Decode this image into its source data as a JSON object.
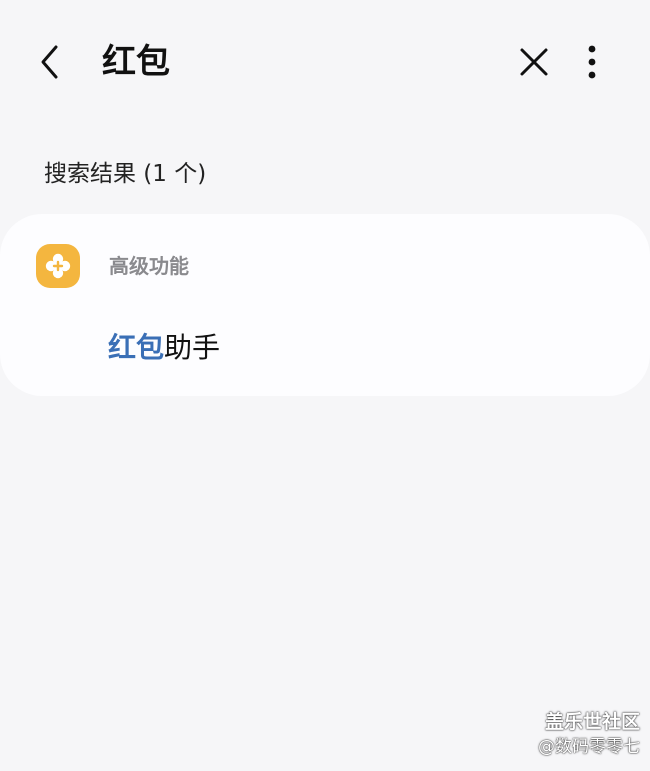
{
  "app_bar": {
    "title": "红包",
    "back_icon": "chevron-left-icon",
    "close_icon": "close-icon",
    "more_icon": "more-vertical-icon"
  },
  "results": {
    "header": "搜索结果 (1 个)",
    "items": [
      {
        "category": "高级功能",
        "icon": "advanced-features-icon",
        "icon_color": "#f4b63f",
        "title_highlight": "红包",
        "title_rest": "助手",
        "highlight_color": "#3a6fb6"
      }
    ]
  },
  "watermark": {
    "line1": "盖乐世社区",
    "line2": "@数码零零七"
  }
}
